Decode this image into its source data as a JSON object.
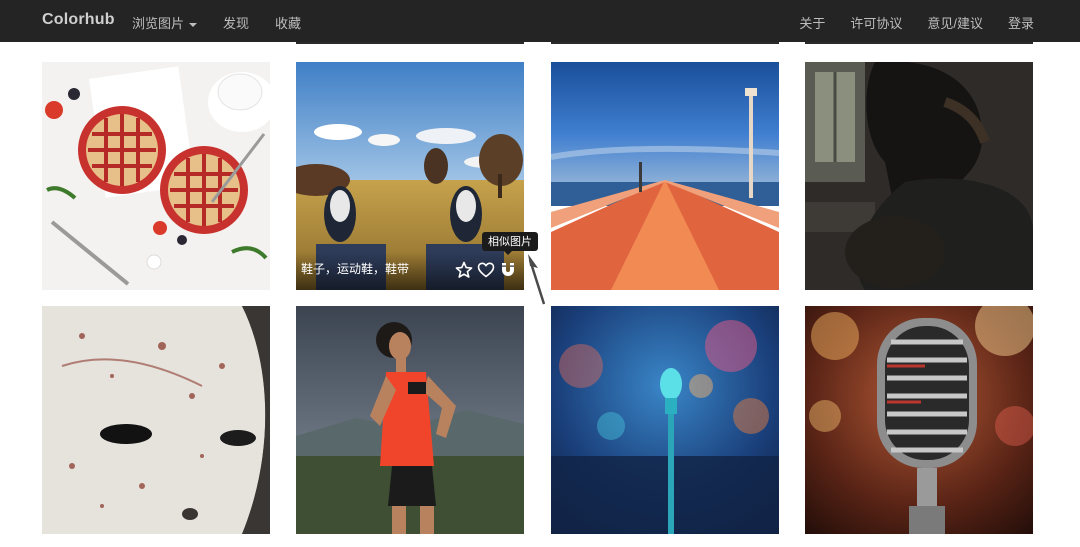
{
  "navbar": {
    "brand": "Colorhub",
    "browse_label": "浏览图片",
    "discover_label": "发现",
    "favorites_label": "收藏",
    "about_label": "关于",
    "license_label": "许可协议",
    "feedback_label": "意见/建议",
    "login_label": "登录"
  },
  "grid": {
    "hover_caption": "鞋子，运动鞋，鞋带",
    "tooltip": "相似图片",
    "overlay_icons": [
      "star-icon",
      "heart-icon",
      "magnet-icon"
    ],
    "tiles": [
      {
        "subject": "berry-pies"
      },
      {
        "subject": "sneakers-in-field"
      },
      {
        "subject": "pier-at-dusk"
      },
      {
        "subject": "guitar-player"
      },
      {
        "subject": "white-mask"
      },
      {
        "subject": "runner-woman"
      },
      {
        "subject": "microphone-concert"
      },
      {
        "subject": "vintage-microphone"
      }
    ]
  }
}
